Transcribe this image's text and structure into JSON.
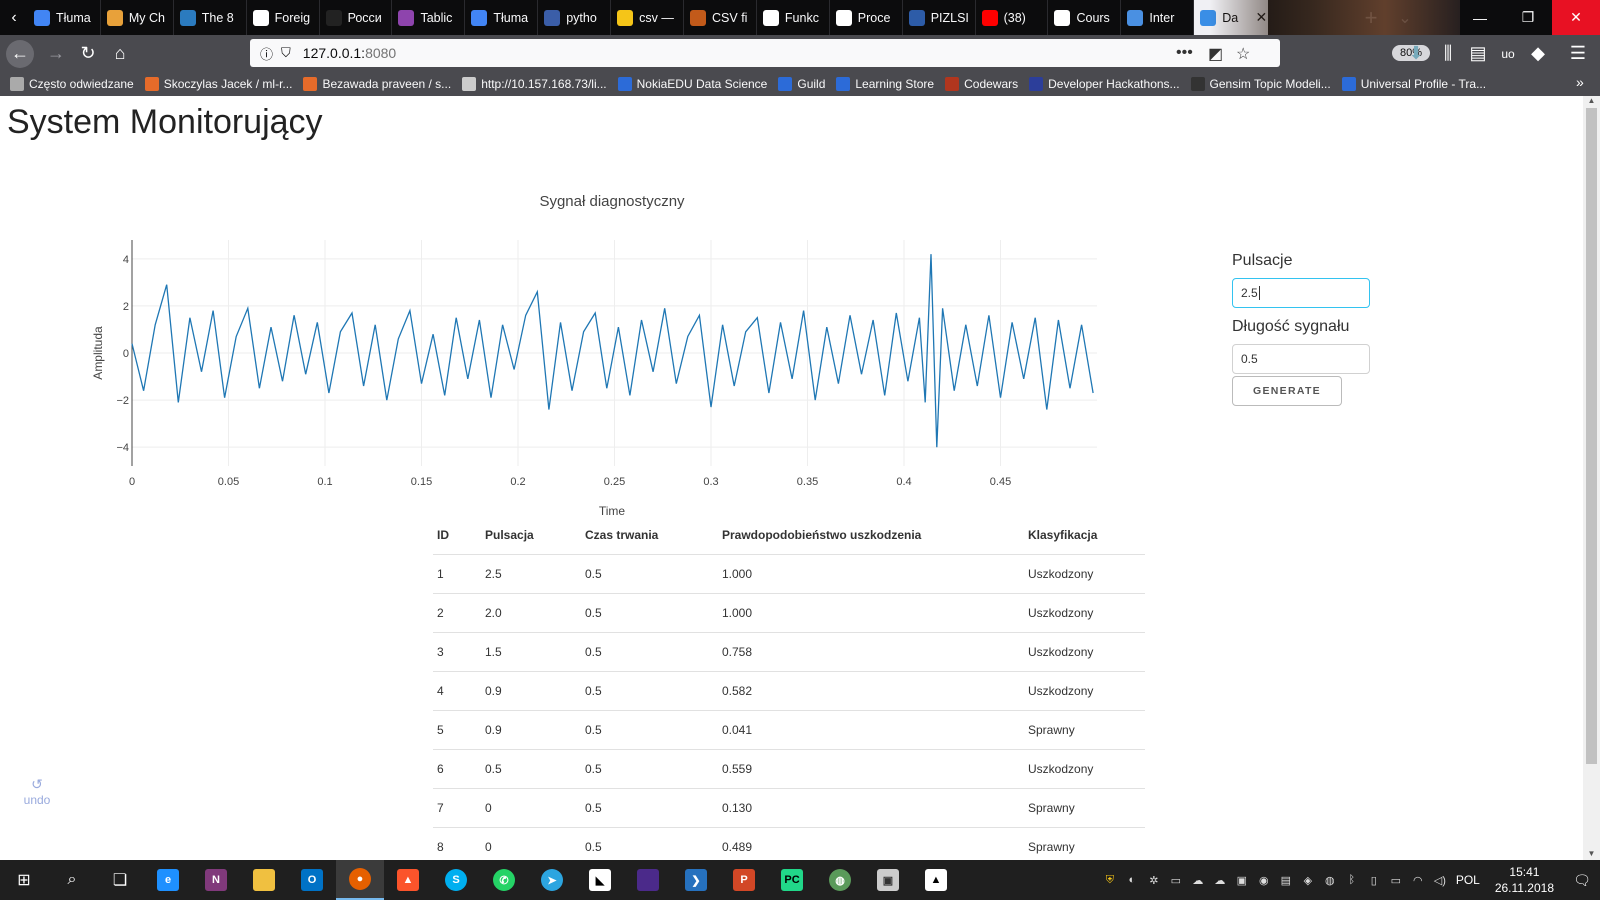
{
  "browser": {
    "tabs": [
      {
        "label": "Tłuma",
        "color": "#4285f4"
      },
      {
        "label": "My Ch",
        "color": "#e8a13a"
      },
      {
        "label": "The 8",
        "color": "#2b7bbf"
      },
      {
        "label": "Foreig",
        "color": "#ffffff"
      },
      {
        "label": "Росси",
        "color": "#222222"
      },
      {
        "label": "Tablic",
        "color": "#8e44ad"
      },
      {
        "label": "Tłuma",
        "color": "#4285f4"
      },
      {
        "label": "pytho",
        "color": "#3b5ea8"
      },
      {
        "label": "csv —",
        "color": "#f5c518"
      },
      {
        "label": "CSV fi",
        "color": "#c25a1a"
      },
      {
        "label": "Funkc",
        "color": "#ffffff"
      },
      {
        "label": "Proce",
        "color": "#ffffff"
      },
      {
        "label": "PIZLSI",
        "color": "#2d5ca8"
      },
      {
        "label": "(38)",
        "color": "#ff0000"
      },
      {
        "label": "Cours",
        "color": "#ffffff"
      },
      {
        "label": "Inter",
        "color": "#4a90e2"
      }
    ],
    "active_tab": {
      "label": "Da",
      "color": "#3a8ee6"
    },
    "url_host": "127.0.0.1:",
    "url_port": "8080",
    "zoom": "80%",
    "bookmarks": [
      {
        "label": "Często odwiedzane",
        "color": "#aaaaaa"
      },
      {
        "label": "Skoczylas Jacek / ml-r...",
        "color": "#e66b2a"
      },
      {
        "label": "Bezawada praveen / s...",
        "color": "#e66b2a"
      },
      {
        "label": "http://10.157.168.73/li...",
        "color": "#cccccc"
      },
      {
        "label": "NokiaEDU Data Science",
        "color": "#2c6bd8"
      },
      {
        "label": "Guild",
        "color": "#2c6bd8"
      },
      {
        "label": "Learning Store",
        "color": "#2c6bd8"
      },
      {
        "label": "Codewars",
        "color": "#b1361e"
      },
      {
        "label": "Developer Hackathons...",
        "color": "#2c3e9a"
      },
      {
        "label": "Gensim Topic Modeli...",
        "color": "#333333"
      },
      {
        "label": "Universal Profile - Tra...",
        "color": "#2c6bd8"
      }
    ]
  },
  "page": {
    "title": "System Monitorujący",
    "controls": {
      "pulse_label": "Pulsacje",
      "pulse_value": "2.5",
      "length_label": "Długość sygnału",
      "length_value": "0.5",
      "generate_label": "GENERATE"
    },
    "undo_label": "undo",
    "table": {
      "headers": [
        "ID",
        "Pulsacja",
        "Czas trwania",
        "Prawdopodobieństwo uszkodzenia",
        "Klasyfikacja"
      ],
      "rows": [
        [
          "1",
          "2.5",
          "0.5",
          "1.000",
          "Uszkodzony"
        ],
        [
          "2",
          "2.0",
          "0.5",
          "1.000",
          "Uszkodzony"
        ],
        [
          "3",
          "1.5",
          "0.5",
          "0.758",
          "Uszkodzony"
        ],
        [
          "4",
          "0.9",
          "0.5",
          "0.582",
          "Uszkodzony"
        ],
        [
          "5",
          "0.9",
          "0.5",
          "0.041",
          "Sprawny"
        ],
        [
          "6",
          "0.5",
          "0.5",
          "0.559",
          "Uszkodzony"
        ],
        [
          "7",
          "0",
          "0.5",
          "0.130",
          "Sprawny"
        ],
        [
          "8",
          "0",
          "0.5",
          "0.489",
          "Sprawny"
        ]
      ]
    }
  },
  "chart_data": {
    "type": "line",
    "title": "Sygnał diagnostyczny",
    "xlabel": "Time",
    "ylabel": "Amplituda",
    "xlim": [
      0,
      0.5
    ],
    "ylim": [
      -4.8,
      4.8
    ],
    "x_ticks": [
      "0",
      "0.05",
      "0.1",
      "0.15",
      "0.2",
      "0.25",
      "0.3",
      "0.35",
      "0.4",
      "0.45"
    ],
    "y_ticks": [
      "4",
      "2",
      "0",
      "−2",
      "−4"
    ],
    "grid": true,
    "line_color": "#1f77b4",
    "series": [
      {
        "x": [
          0.0,
          0.006,
          0.012,
          0.018,
          0.024,
          0.03,
          0.036,
          0.042,
          0.048,
          0.054,
          0.06,
          0.066,
          0.072,
          0.078,
          0.084,
          0.09,
          0.096,
          0.102,
          0.108,
          0.114,
          0.12,
          0.126,
          0.132,
          0.138,
          0.144,
          0.15,
          0.156,
          0.162,
          0.168,
          0.174,
          0.18,
          0.186,
          0.192,
          0.198,
          0.204,
          0.21,
          0.216,
          0.222,
          0.228,
          0.234,
          0.24,
          0.246,
          0.252,
          0.258,
          0.264,
          0.27,
          0.276,
          0.282,
          0.288,
          0.294,
          0.3,
          0.306,
          0.312,
          0.318,
          0.324,
          0.33,
          0.336,
          0.342,
          0.348,
          0.354,
          0.36,
          0.366,
          0.372,
          0.378,
          0.384,
          0.39,
          0.396,
          0.402,
          0.408,
          0.411,
          0.414,
          0.417,
          0.42,
          0.426,
          0.432,
          0.438,
          0.444,
          0.45,
          0.456,
          0.462,
          0.468,
          0.474,
          0.48,
          0.486,
          0.492,
          0.498
        ],
        "y": [
          0.4,
          -1.6,
          1.2,
          2.9,
          -2.1,
          1.5,
          -0.8,
          1.8,
          -1.9,
          0.7,
          1.9,
          -1.5,
          1.1,
          -1.2,
          1.6,
          -0.9,
          1.3,
          -1.7,
          0.9,
          1.7,
          -1.4,
          1.2,
          -2.0,
          0.6,
          1.8,
          -1.3,
          0.8,
          -1.8,
          1.5,
          -1.1,
          1.4,
          -1.9,
          1.2,
          -0.7,
          1.6,
          2.6,
          -2.4,
          1.3,
          -1.6,
          0.9,
          1.7,
          -1.5,
          1.1,
          -1.8,
          1.4,
          -0.8,
          1.9,
          -1.3,
          0.7,
          1.6,
          -2.3,
          1.2,
          -1.4,
          0.9,
          1.5,
          -1.7,
          1.3,
          -1.1,
          1.8,
          -2.0,
          1.1,
          -1.3,
          1.6,
          -0.9,
          1.4,
          -1.8,
          1.7,
          -1.2,
          1.5,
          -2.1,
          4.2,
          -4.0,
          1.9,
          -1.6,
          1.2,
          -1.4,
          1.6,
          -1.9,
          1.3,
          -1.1,
          1.5,
          -2.4,
          1.4,
          -1.5,
          1.2,
          -1.7
        ]
      }
    ]
  }
}
